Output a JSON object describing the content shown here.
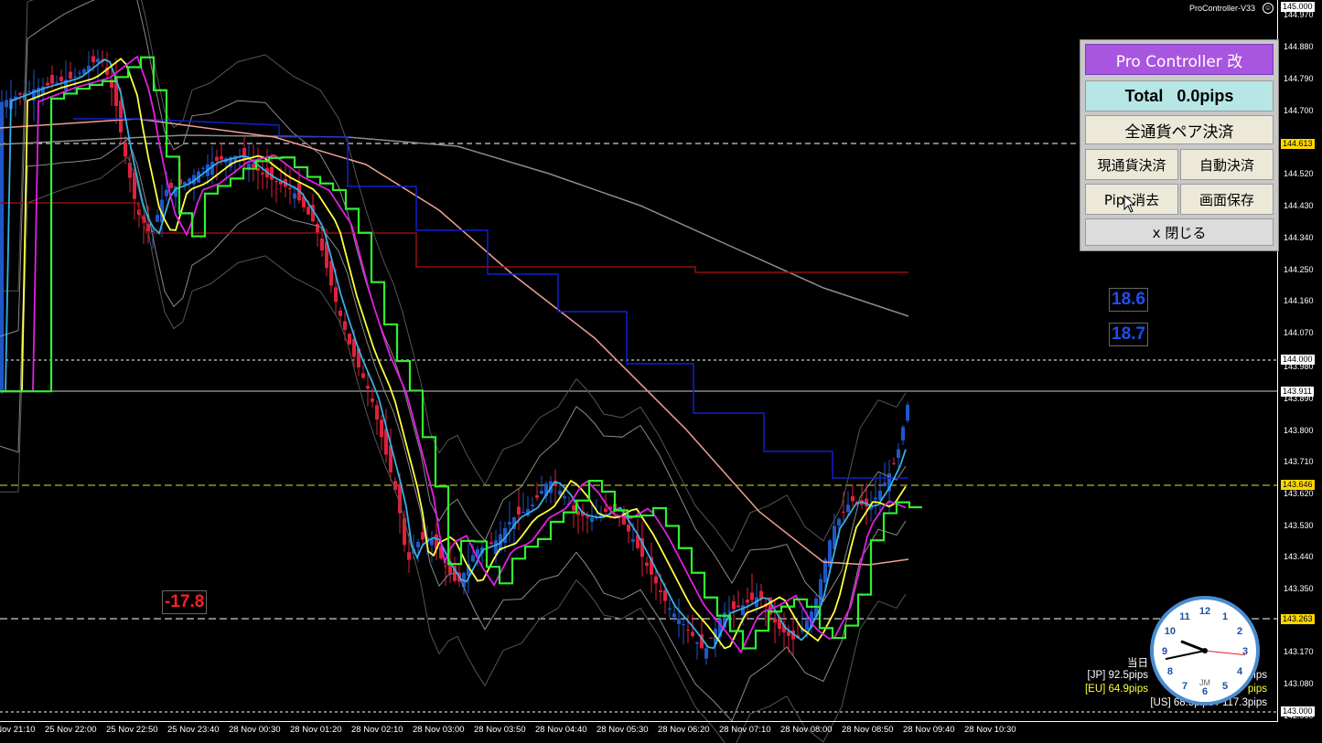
{
  "window": {
    "title": "ProController-V33"
  },
  "panel": {
    "title": "Pro Controller 改",
    "total": "Total   0.0pips",
    "all_close": "全通貨ペア決済",
    "current_close": "現通貨決済",
    "auto_close": "自動決済",
    "pips_clear": "Pips消去",
    "screen_save": "画面保存",
    "close": "x 閉じる"
  },
  "y_axis": [
    "145.000",
    "144.970",
    "144.880",
    "144.790",
    "144.700",
    "144.610",
    "144.520",
    "144.430",
    "144.340",
    "144.250",
    "144.160",
    "144.070",
    "143.980",
    "143.890",
    "143.800",
    "143.710",
    "143.620",
    "143.530",
    "143.440",
    "143.350",
    "143.260",
    "143.170",
    "143.080",
    "142.990"
  ],
  "price_tags": {
    "top": "145.000",
    "upper_dashed": "144.613",
    "mid_dashed": "144.000",
    "current": "143.911",
    "yellow_dashed": "143.646",
    "lower_dashed": "143.263",
    "bottom": "143.000"
  },
  "x_axis": [
    "25 Nov 21:10",
    "25 Nov 22:00",
    "25 Nov 22:50",
    "25 Nov 23:40",
    "28 Nov 00:30",
    "28 Nov 01:20",
    "28 Nov 02:10",
    "28 Nov 03:00",
    "28 Nov 03:50",
    "28 Nov 04:40",
    "28 Nov 05:30",
    "28 Nov 06:20",
    "28 Nov 07:10",
    "28 Nov 08:00",
    "28 Nov 08:50",
    "28 Nov 09:40",
    "28 Nov 10:30"
  ],
  "pip_labels": {
    "up1": "18.6",
    "up2": "18.7",
    "down": "-17.8"
  },
  "stats": {
    "header": "当日",
    "jp": "[JP] 92.5pips",
    "eu": "[EU] 64.9pips",
    "us": "[US] 68.5pips / 117.3pips",
    "jp_right": "pips",
    "eu_right": "pips",
    "us_right": "7.3pips"
  },
  "clock": {
    "numbers": [
      "12",
      "1",
      "2",
      "3",
      "4",
      "5",
      "6",
      "7",
      "8",
      "9",
      "10",
      "11"
    ],
    "mark": "JM",
    "hour": 9,
    "minute": 43,
    "second": 16
  },
  "colors": {
    "up_candle": "#1e56c8",
    "down_candle": "#e0203c",
    "sma_fast": "#35b0e8",
    "sma_mid": "#ffff40",
    "sma_slow": "#e020e0",
    "step_green": "#30f030",
    "blue_step": "#1020d0",
    "dark_red_step": "#901010",
    "ma_salmon": "#f0a090",
    "yellow_dashed": "#e0e030"
  }
}
